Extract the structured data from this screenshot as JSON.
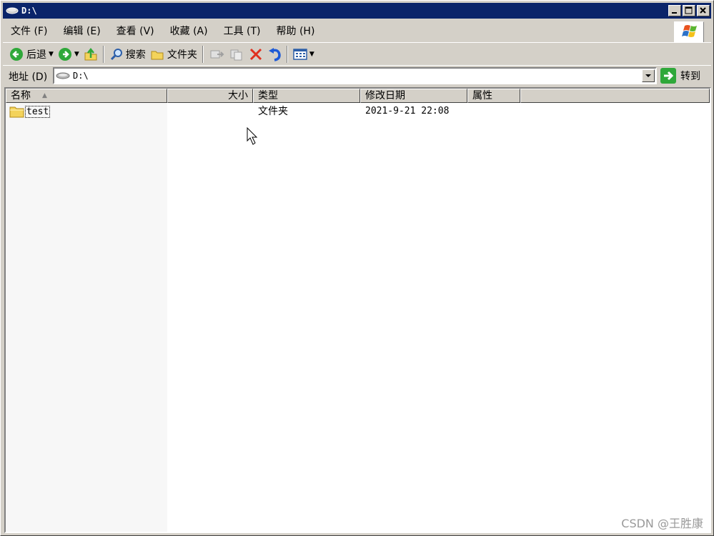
{
  "window": {
    "title": "D:\\"
  },
  "menu": {
    "items": [
      "文件 (F)",
      "编辑 (E)",
      "查看 (V)",
      "收藏 (A)",
      "工具 (T)",
      "帮助 (H)"
    ]
  },
  "toolbar": {
    "back": "后退",
    "search": "搜索",
    "folders": "文件夹"
  },
  "address": {
    "label": "地址 (D)",
    "value": "D:\\",
    "go": "转到"
  },
  "list": {
    "columns": [
      "名称",
      "大小",
      "类型",
      "修改日期",
      "属性"
    ],
    "rows": [
      {
        "name": "test",
        "size": "",
        "type": "文件夹",
        "modified": "2021-9-21 22:08",
        "attrs": ""
      }
    ]
  },
  "watermark": "CSDN @王胜康",
  "colors": {
    "titlebar": "#0a246a",
    "face": "#d4d0c8",
    "go_green": "#2fa83a",
    "delete_red": "#e0301e",
    "undo_blue": "#1d5ad6"
  }
}
